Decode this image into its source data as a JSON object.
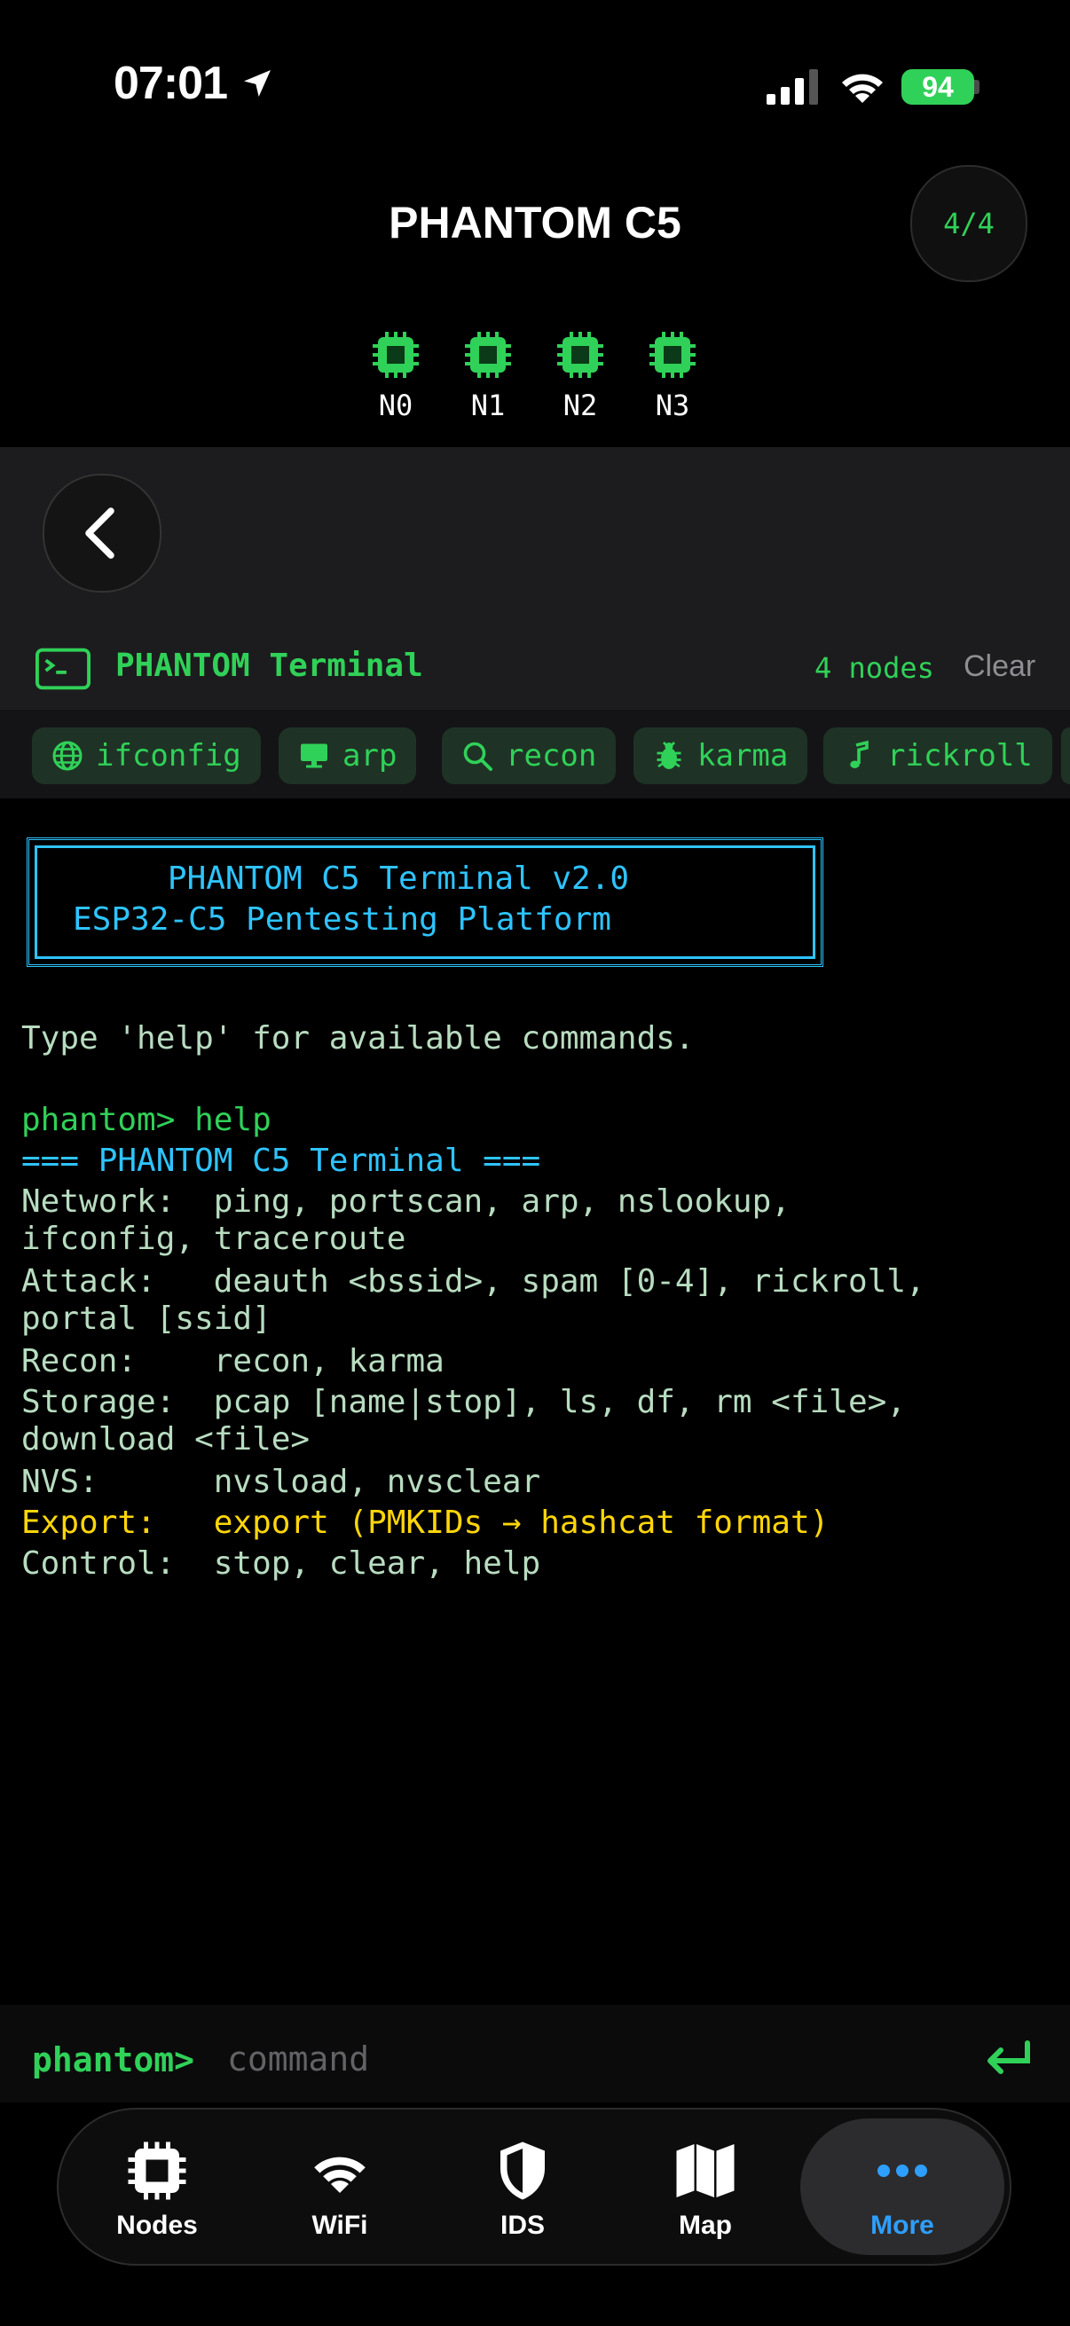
{
  "status": {
    "time": "07:01",
    "battery": "94"
  },
  "header": {
    "title": "PHANTOM C5",
    "count": "4/4"
  },
  "nodes": [
    "N0",
    "N1",
    "N2",
    "N3"
  ],
  "terminal_header": {
    "title": "PHANTOM Terminal",
    "nodes_count": "4 nodes",
    "clear": "Clear"
  },
  "chips": [
    {
      "label": "ifconfig",
      "icon": "globe-icon"
    },
    {
      "label": "arp",
      "icon": "monitor-icon"
    },
    {
      "label": "recon",
      "icon": "search-icon"
    },
    {
      "label": "karma",
      "icon": "bug-icon"
    },
    {
      "label": "rickroll",
      "icon": "music-note-icon"
    }
  ],
  "banner": {
    "line1": "PHANTOM C5 Terminal v2.0",
    "line2": "ESP32-C5 Pentesting Platform"
  },
  "output": [
    "Type 'help' for available commands.",
    "phantom> help",
    "=== PHANTOM C5 Terminal ===",
    "Network:  ping, portscan, arp, nslookup,",
    "ifconfig, traceroute",
    "Attack:   deauth <bssid>, spam [0-4], rickroll,",
    "portal [ssid]",
    "Recon:    recon, karma",
    "Storage:  pcap [name|stop], ls, df, rm <file>,",
    "download <file>",
    "NVS:      nvsload, nvsclear",
    "Export:   export (PMKIDs → hashcat format)",
    "Control:  stop, clear, help"
  ],
  "input": {
    "prompt": "phantom>",
    "placeholder": "command"
  },
  "tabs": [
    {
      "label": "Nodes",
      "icon": "chip-icon"
    },
    {
      "label": "WiFi",
      "icon": "wifi-icon"
    },
    {
      "label": "IDS",
      "icon": "shield-icon"
    },
    {
      "label": "Map",
      "icon": "map-icon"
    },
    {
      "label": "More",
      "icon": "more-icon"
    }
  ],
  "colors": {
    "accent_green": "#30d158",
    "accent_cyan": "#2ec4ff",
    "accent_yellow": "#ffd60a",
    "active_tab": "#2e9fff"
  }
}
